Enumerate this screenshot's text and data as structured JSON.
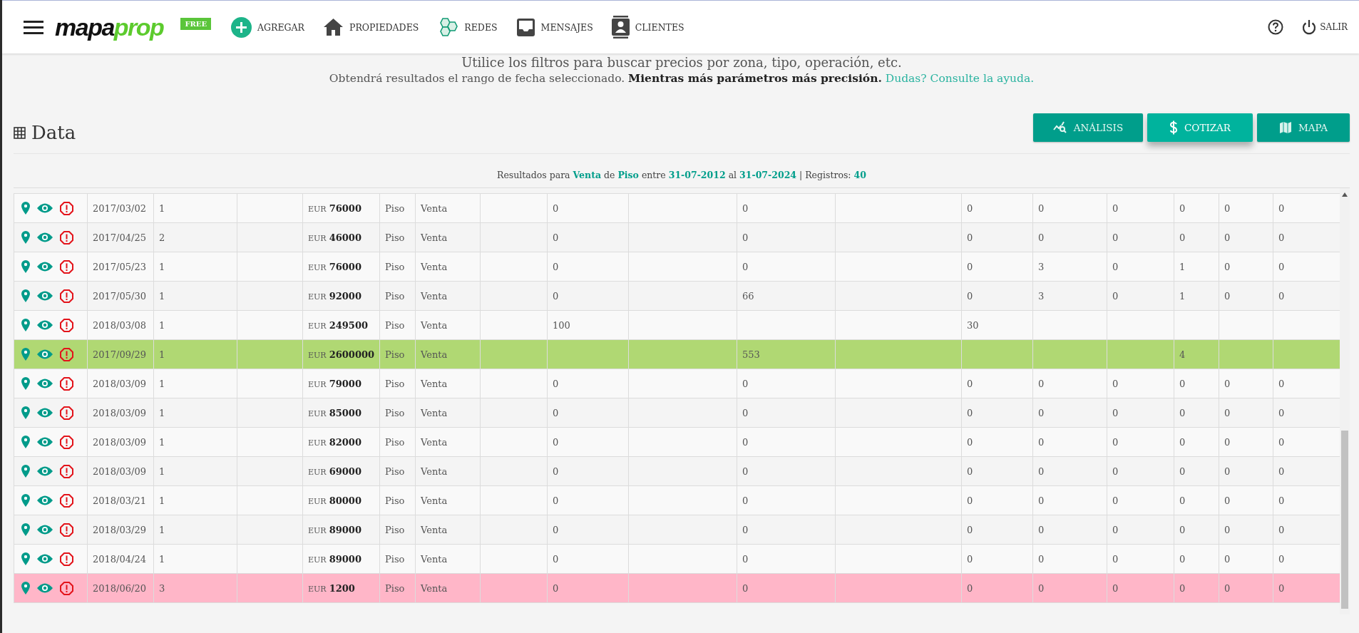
{
  "header": {
    "logo": {
      "part_1": "mapa",
      "part_2": "prop"
    },
    "badge": "FREE",
    "nav": [
      {
        "kind": "add",
        "label": "AGREGAR"
      },
      {
        "kind": "home",
        "label": "PROPIEDADES"
      },
      {
        "kind": "network",
        "label": "REDES"
      },
      {
        "kind": "inbox",
        "label": "MENSAJES"
      },
      {
        "kind": "contacts",
        "label": "CLIENTES"
      }
    ],
    "logout": "SALIR"
  },
  "intro": {
    "line_1": "Utilice los filtros para buscar precios por zona, tipo, operación, etc.",
    "line_2": "Obtendrá resultados el rango de fecha seleccionado. **Mientras más parámetros más precisión.**",
    "help_link": "Dudas? Consulte la ayuda."
  },
  "section": {
    "title": "Data"
  },
  "actions": [
    {
      "kind": "analysis",
      "label": "ANÁLISIS",
      "selected": false
    },
    {
      "kind": "quote",
      "label": "COTIZAR",
      "selected": true
    },
    {
      "kind": "map",
      "label": "MAPA",
      "selected": false
    }
  ],
  "summary": "Resultados para **Venta** de **Piso** entre **31-07-2012** al **31-07-2024** | Registros: **40**",
  "table": {
    "rows": [
      {
        "date": "2017/03/02",
        "column_3": "1",
        "price": {
          "currency": "EUR",
          "amount": "76000"
        },
        "type": "Piso",
        "operation": "Venta",
        "column_9": "0",
        "column_11": "0",
        "column_13": "0",
        "column_14": "0",
        "column_15": "0",
        "column_16": "0",
        "column_17": "0",
        "column_18": "0"
      },
      {
        "date": "2017/04/25",
        "column_3": "2",
        "price": {
          "currency": "EUR",
          "amount": "46000"
        },
        "type": "Piso",
        "operation": "Venta",
        "column_9": "0",
        "column_11": "0",
        "column_13": "0",
        "column_14": "0",
        "column_15": "0",
        "column_16": "0",
        "column_17": "0",
        "column_18": "0"
      },
      {
        "date": "2017/05/23",
        "column_3": "1",
        "price": {
          "currency": "EUR",
          "amount": "76000"
        },
        "type": "Piso",
        "operation": "Venta",
        "column_9": "0",
        "column_11": "0",
        "column_13": "0",
        "column_14": "3",
        "column_15": "0",
        "column_16": "1",
        "column_17": "0",
        "column_18": "0"
      },
      {
        "date": "2017/05/30",
        "column_3": "1",
        "price": {
          "currency": "EUR",
          "amount": "92000"
        },
        "type": "Piso",
        "operation": "Venta",
        "column_9": "0",
        "column_11": "66",
        "column_13": "0",
        "column_14": "3",
        "column_15": "0",
        "column_16": "1",
        "column_17": "0",
        "column_18": "0"
      },
      {
        "date": "2018/03/08",
        "column_3": "1",
        "price": {
          "currency": "EUR",
          "amount": "249500"
        },
        "type": "Piso",
        "operation": "Venta",
        "column_9": "100",
        "column_13": "30"
      },
      {
        "date": "2017/09/29",
        "column_3": "1",
        "price": {
          "currency": "EUR",
          "amount": "2600000"
        },
        "type": "Piso",
        "operation": "Venta",
        "color": "#b0d873",
        "column_11": "553",
        "column_16": "4"
      },
      {
        "date": "2018/03/09",
        "column_3": "1",
        "price": {
          "currency": "EUR",
          "amount": "79000"
        },
        "type": "Piso",
        "operation": "Venta",
        "column_9": "0",
        "column_11": "0",
        "column_13": "0",
        "column_14": "0",
        "column_15": "0",
        "column_16": "0",
        "column_17": "0",
        "column_18": "0"
      },
      {
        "date": "2018/03/09",
        "column_3": "1",
        "price": {
          "currency": "EUR",
          "amount": "85000"
        },
        "type": "Piso",
        "operation": "Venta",
        "column_9": "0",
        "column_11": "0",
        "column_13": "0",
        "column_14": "0",
        "column_15": "0",
        "column_16": "0",
        "column_17": "0",
        "column_18": "0"
      },
      {
        "date": "2018/03/09",
        "column_3": "1",
        "price": {
          "currency": "EUR",
          "amount": "82000"
        },
        "type": "Piso",
        "operation": "Venta",
        "column_9": "0",
        "column_11": "0",
        "column_13": "0",
        "column_14": "0",
        "column_15": "0",
        "column_16": "0",
        "column_17": "0",
        "column_18": "0"
      },
      {
        "date": "2018/03/09",
        "column_3": "1",
        "price": {
          "currency": "EUR",
          "amount": "69000"
        },
        "type": "Piso",
        "operation": "Venta",
        "column_9": "0",
        "column_11": "0",
        "column_13": "0",
        "column_14": "0",
        "column_15": "0",
        "column_16": "0",
        "column_17": "0",
        "column_18": "0"
      },
      {
        "date": "2018/03/21",
        "column_3": "1",
        "price": {
          "currency": "EUR",
          "amount": "80000"
        },
        "type": "Piso",
        "operation": "Venta",
        "column_9": "0",
        "column_11": "0",
        "column_13": "0",
        "column_14": "0",
        "column_15": "0",
        "column_16": "0",
        "column_17": "0",
        "column_18": "0"
      },
      {
        "date": "2018/03/29",
        "column_3": "1",
        "price": {
          "currency": "EUR",
          "amount": "89000"
        },
        "type": "Piso",
        "operation": "Venta",
        "column_9": "0",
        "column_11": "0",
        "column_13": "0",
        "column_14": "0",
        "column_15": "0",
        "column_16": "0",
        "column_17": "0",
        "column_18": "0"
      },
      {
        "date": "2018/04/24",
        "column_3": "1",
        "price": {
          "currency": "EUR",
          "amount": "89000"
        },
        "type": "Piso",
        "operation": "Venta",
        "column_9": "0",
        "column_11": "0",
        "column_13": "0",
        "column_14": "0",
        "column_15": "0",
        "column_16": "0",
        "column_17": "0",
        "column_18": "0"
      },
      {
        "date": "2018/06/20",
        "column_3": "3",
        "price": {
          "currency": "EUR",
          "amount": "1200"
        },
        "type": "Piso",
        "operation": "Venta",
        "color": "#ffb6c8",
        "column_9": "0",
        "column_11": "0",
        "column_13": "0",
        "column_14": "0",
        "column_15": "0",
        "column_16": "0",
        "column_17": "0",
        "column_18": "0"
      }
    ]
  }
}
